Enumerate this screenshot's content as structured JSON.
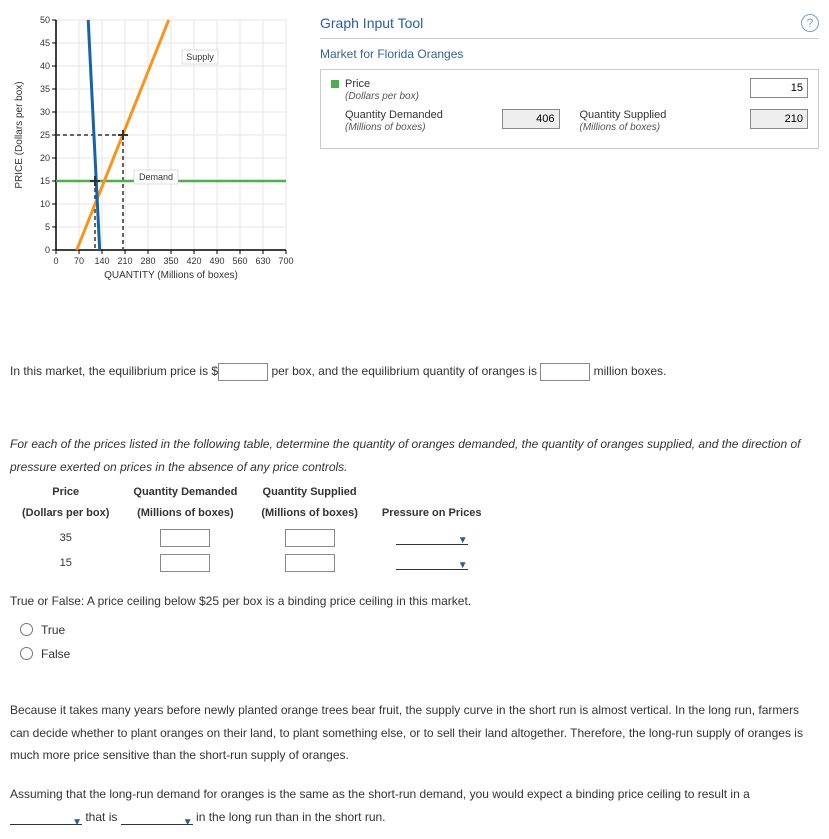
{
  "chart_data": {
    "type": "line",
    "title": "",
    "xlabel": "QUANTITY (Millions of boxes)",
    "ylabel": "PRICE (Dollars per box)",
    "x_ticks": [
      0,
      70,
      140,
      210,
      280,
      350,
      420,
      490,
      560,
      630,
      700
    ],
    "y_ticks": [
      0,
      5,
      10,
      15,
      20,
      25,
      30,
      35,
      40,
      45,
      50
    ],
    "xlim": [
      0,
      700
    ],
    "ylim": [
      0,
      50
    ],
    "series": [
      {
        "name": "Supply",
        "color": "#f7941d",
        "points": [
          [
            63,
            0
          ],
          [
            343,
            50
          ]
        ],
        "marker_at": [
          203,
          25
        ]
      },
      {
        "name": "Demand",
        "color": "#1763a9",
        "points": [
          [
            98,
            50
          ],
          [
            133,
            0
          ]
        ],
        "marker_at": [
          119,
          15
        ]
      },
      {
        "name": "Price line",
        "color": "#4cae4c",
        "points": [
          [
            0,
            15
          ],
          [
            700,
            15
          ]
        ]
      }
    ],
    "guides": [
      {
        "type": "dashed",
        "from": [
          119,
          0
        ],
        "to": [
          119,
          15
        ]
      },
      {
        "type": "dashed",
        "from": [
          203,
          0
        ],
        "to": [
          203,
          25
        ]
      },
      {
        "type": "dashed",
        "from": [
          0,
          25
        ],
        "to": [
          203,
          25
        ]
      }
    ],
    "labels": [
      {
        "text": "Supply",
        "x": 420,
        "y": 42
      },
      {
        "text": "Demand",
        "x": 290,
        "y": 16
      }
    ]
  },
  "tool": {
    "title": "Graph Input Tool",
    "market_title": "Market for Florida Oranges",
    "price": {
      "label": "Price",
      "sublabel": "(Dollars per box)",
      "value": "15"
    },
    "qty_demanded": {
      "label": "Quantity Demanded",
      "sublabel": "(Millions of boxes)",
      "value": "406"
    },
    "qty_supplied": {
      "label": "Quantity Supplied",
      "sublabel": "(Millions of boxes)",
      "value": "210"
    }
  },
  "q1": {
    "preA": "In this market, the equilibrium price is",
    "prefix": "$",
    "mid": "per box, and the equilibrium quantity of oranges is",
    "suffix": "million boxes."
  },
  "instructions": "For each of the prices listed in the following table, determine the quantity of oranges demanded, the quantity of oranges supplied, and the direction of pressure exerted on prices in the absence of any price controls.",
  "table": {
    "headers": {
      "price": "Price",
      "price_sub": "(Dollars per box)",
      "qd": "Quantity Demanded",
      "qd_sub": "(Millions of boxes)",
      "qs": "Quantity Supplied",
      "qs_sub": "(Millions of boxes)",
      "pressure": "Pressure on Prices"
    },
    "rows": [
      {
        "price": "35"
      },
      {
        "price": "15"
      }
    ]
  },
  "tf": {
    "question": "True or False: A price ceiling below $25 per box is a binding price ceiling in this market.",
    "true_label": "True",
    "false_label": "False"
  },
  "paragraph": "Because it takes many years before newly planted orange trees bear fruit, the supply curve in the short run is almost vertical. In the long run, farmers can decide whether to plant oranges on their land, to plant something else, or to sell their land altogether. Therefore, the long-run supply of oranges is much more price sensitive than the short-run supply of oranges.",
  "q_last": {
    "preA": "Assuming that the long-run demand for oranges is the same as the short-run demand, you would expect a binding price ceiling to result in a",
    "mid": "that is",
    "suffix": "in the long run than in the short run."
  }
}
